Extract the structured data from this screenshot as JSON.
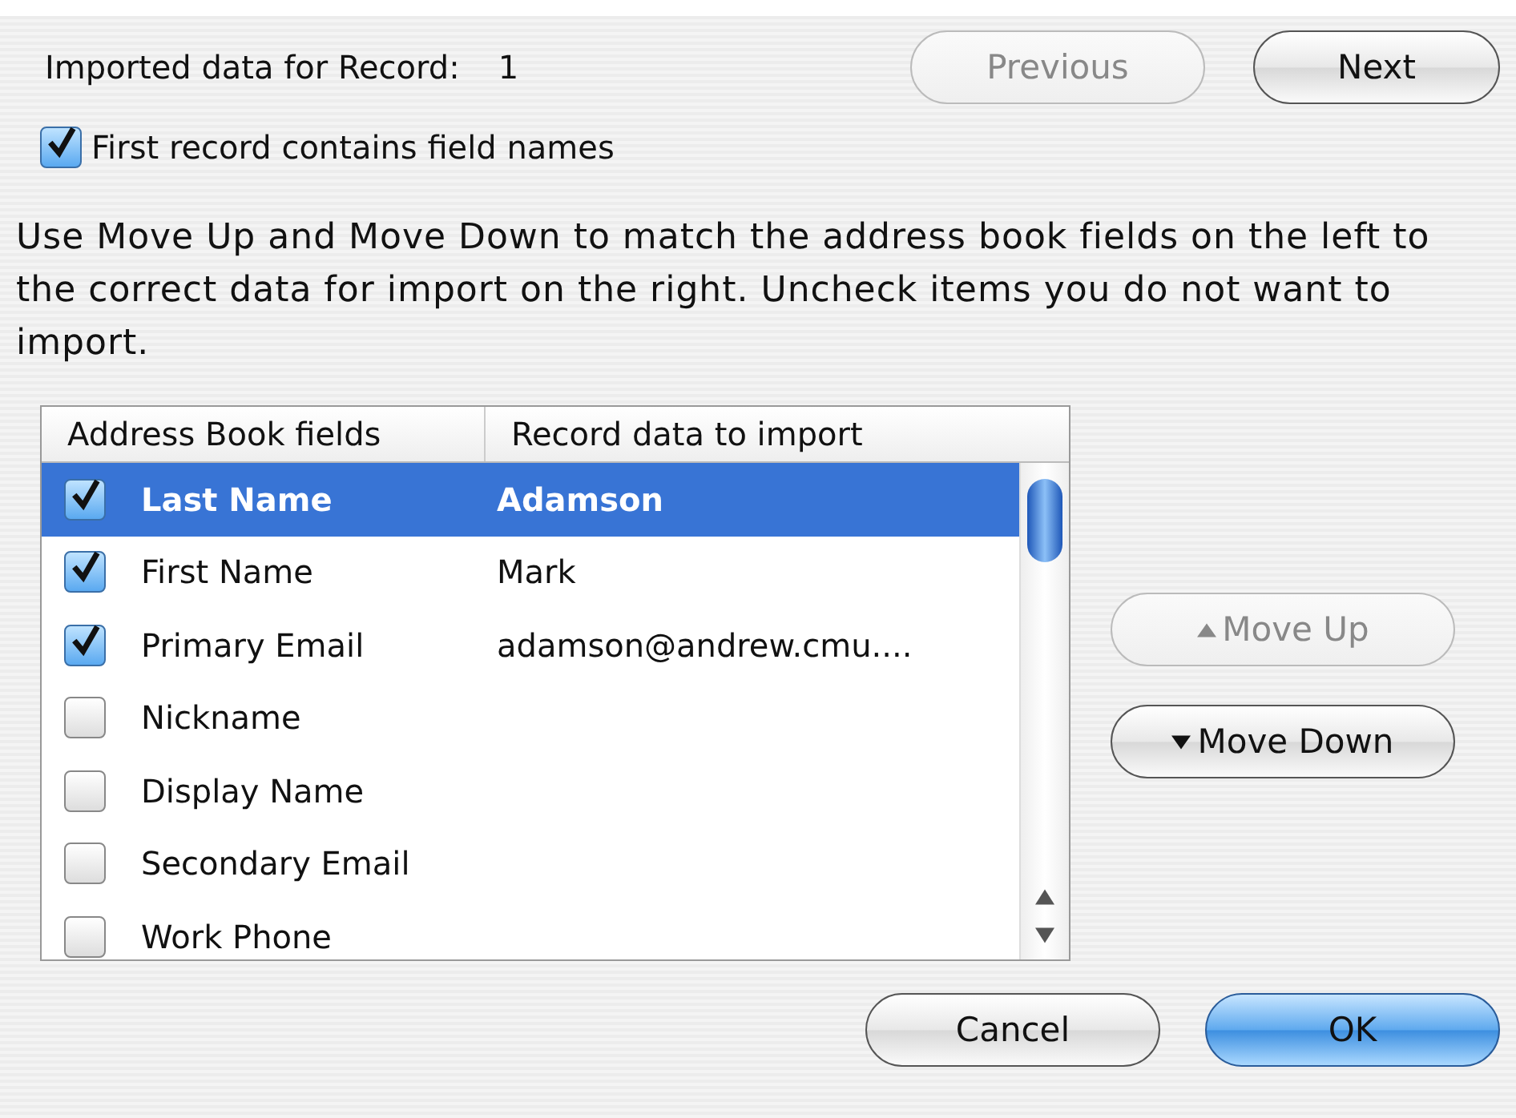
{
  "record": {
    "label": "Imported data for Record:",
    "number": "1"
  },
  "nav_buttons": [
    {
      "label": "Previous",
      "disabled": true
    },
    {
      "label": "Next",
      "disabled": false
    }
  ],
  "first_record_option": {
    "label": "First record contains field names",
    "checked": true
  },
  "instructions": "Use Move Up and Move Down to match the address book fields on the left to the correct data for import on the right. Uncheck items you do not want to import.",
  "table": {
    "columns": [
      "Address Book fields",
      "Record data to import"
    ],
    "rows": [
      {
        "field": "Last Name",
        "data": "Adamson",
        "checked": true,
        "selected": true
      },
      {
        "field": "First Name",
        "data": "Mark",
        "checked": true,
        "selected": false
      },
      {
        "field": "Primary Email",
        "data": "adamson@andrew.cmu....",
        "checked": true,
        "selected": false
      },
      {
        "field": "Nickname",
        "checked": false,
        "selected": false
      },
      {
        "field": "Display Name",
        "checked": false,
        "selected": false
      },
      {
        "field": "Secondary Email",
        "checked": false,
        "selected": false
      },
      {
        "field": "Work Phone",
        "checked": false,
        "selected": false
      }
    ]
  },
  "move_buttons": [
    {
      "kind": "up",
      "label": "Move Up",
      "disabled": true
    },
    {
      "kind": "down",
      "label": "Move Down",
      "disabled": false
    }
  ],
  "dialog_buttons": [
    {
      "label": "Cancel",
      "default": false
    },
    {
      "label": "OK",
      "default": true
    }
  ]
}
